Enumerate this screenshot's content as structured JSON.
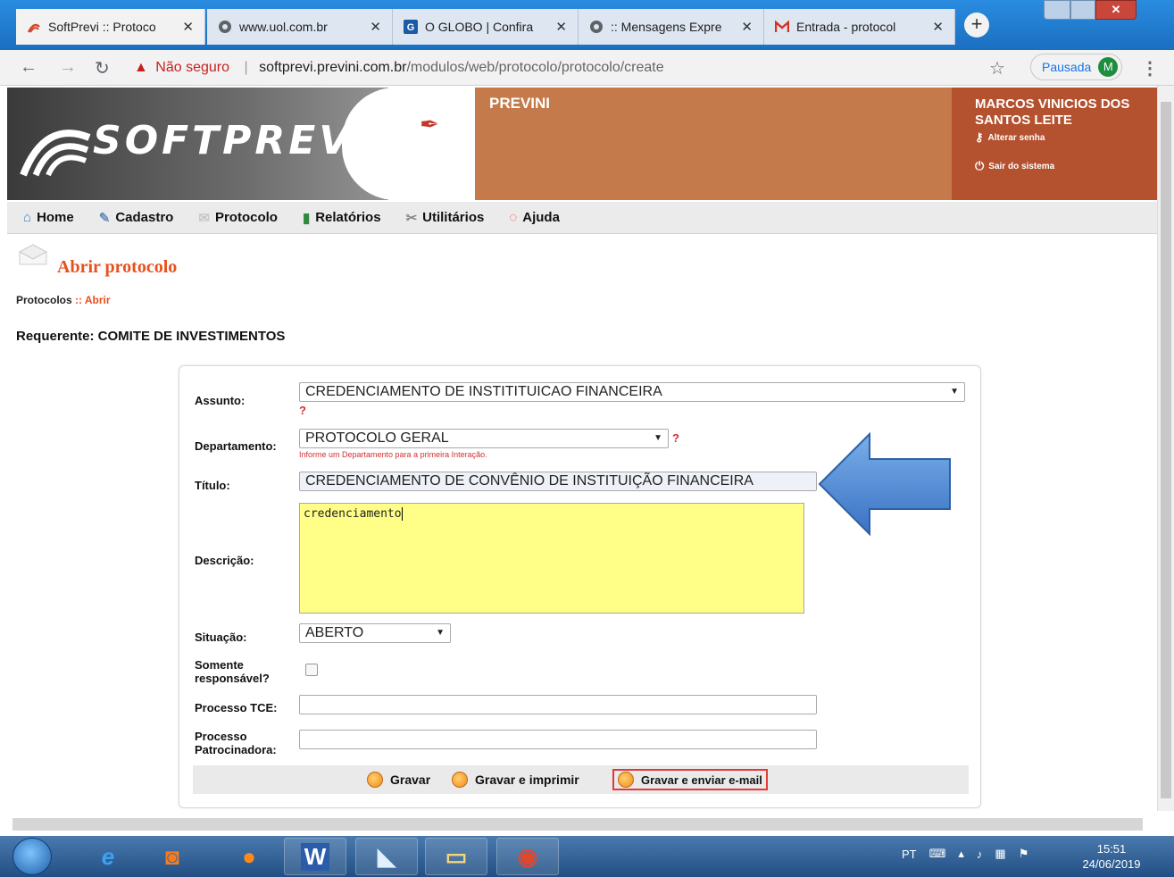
{
  "browser": {
    "tabs": [
      {
        "title": "SoftPrevi :: Protoco",
        "active": true
      },
      {
        "title": "www.uol.com.br",
        "active": false
      },
      {
        "title": "O GLOBO | Confira",
        "active": false
      },
      {
        "title": ":: Mensagens Expre",
        "active": false
      },
      {
        "title": "Entrada - protocol",
        "active": false
      }
    ],
    "url_warning": "Não seguro",
    "url_host": "softprevi.previni.com.br",
    "url_path": "/modulos/web/protocolo/protocolo/create",
    "paused_label": "Pausada",
    "avatar_letter": "M"
  },
  "header": {
    "logo": "SOFTPREVI",
    "org": "PREVINI",
    "user_name": "MARCOS VINICIOS DOS SANTOS LEITE",
    "change_password": "Alterar senha",
    "logout": "Sair do sistema"
  },
  "menu": {
    "items": [
      "Home",
      "Cadastro",
      "Protocolo",
      "Relatórios",
      "Utilitários",
      "Ajuda"
    ]
  },
  "page": {
    "title": "Abrir protocolo",
    "breadcrumb_root": "Protocolos",
    "breadcrumb_sep": " :: ",
    "breadcrumb_current": "Abrir",
    "requerente": "Requerente: COMITE DE INVESTIMENTOS"
  },
  "form": {
    "assunto_label": "Assunto:",
    "assunto_value": "CREDENCIAMENTO DE INSTITITUICAO FINANCEIRA",
    "departamento_label": "Departamento:",
    "departamento_value": "PROTOCOLO GERAL",
    "departamento_hint": "Informe um Departamento para a primeira Interação.",
    "required_mark": "?",
    "titulo_label": "Título:",
    "titulo_value": "CREDENCIAMENTO DE CONVÊNIO DE INSTITUIÇÃO FINANCEIRA",
    "descricao_label": "Descrição:",
    "descricao_value": "credenciamento",
    "situacao_label": "Situação:",
    "situacao_value": "ABERTO",
    "somente_label": "Somente responsável?",
    "processo_tce_label": "Processo TCE:",
    "processo_tce_value": "",
    "processo_patro_label": "Processo Patrocinadora:",
    "processo_patro_value": ""
  },
  "actions": {
    "gravar": "Gravar",
    "gravar_imprimir": "Gravar e imprimir",
    "gravar_email": "Gravar e enviar e-mail"
  },
  "taskbar": {
    "lang": "PT",
    "time": "15:51",
    "date": "24/06/2019"
  },
  "colors": {
    "accent": "#e8501b",
    "header_org": "#c47a4a",
    "header_user": "#b4512e",
    "textarea_bg": "#ffff88",
    "arrow": "#4a86d8"
  }
}
